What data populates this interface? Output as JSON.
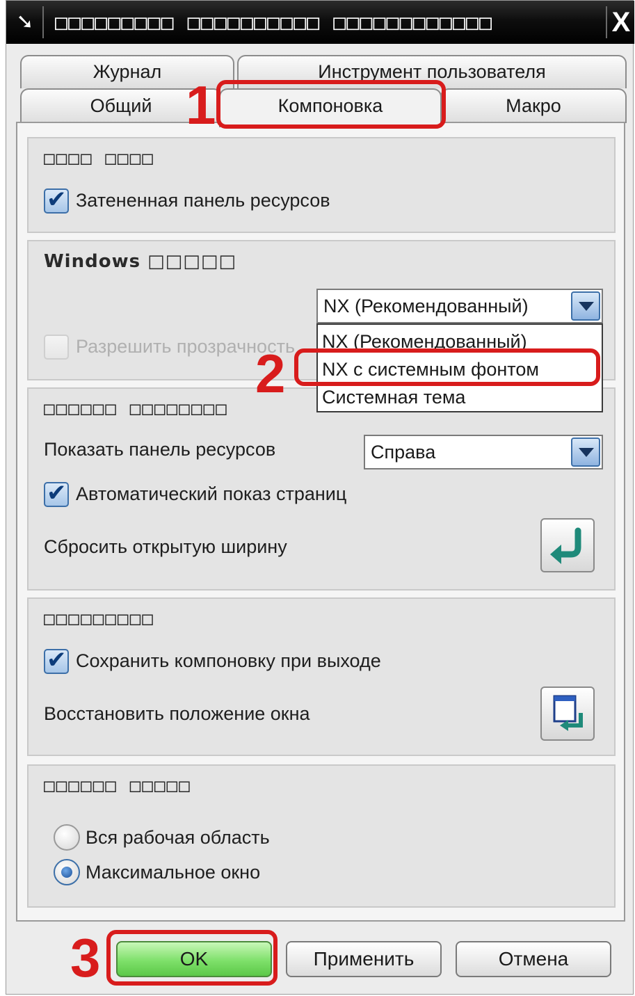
{
  "window": {
    "title": "□□□□□□□□□ □□□□□□□□□□ □□□□□□□□□□□□",
    "title_icon": "pin-icon",
    "close_label": "X"
  },
  "tabs": {
    "journal": "Журнал",
    "user_tool": "Инструмент пользователя",
    "general": "Общий",
    "layout": "Компоновка",
    "macro": "Макро",
    "active": "Компоновка"
  },
  "group_resource": {
    "title": "□□□□ □□□□",
    "shaded_panel_label": "Затененная панель ресурсов",
    "shaded_panel_checked": true
  },
  "group_windows": {
    "title": "Windows □□□□□",
    "theme_selected": "NX (Рекомендованный)",
    "theme_options": [
      "NX (Рекомендованный)",
      "NX с системным фонтом",
      "Системная тема"
    ],
    "highlighted_option": "NX с системным фонтом",
    "transparency_label": "Разрешить прозрачность",
    "transparency_checked": false,
    "transparency_enabled": false
  },
  "group_panel": {
    "title": "□□□□□□ □□□□□□□□",
    "show_panel_label": "Показать панель ресурсов",
    "show_panel_value": "Справа",
    "auto_show_label": "Автоматический показ страниц",
    "auto_show_checked": true,
    "reset_width_label": "Сбросить открытую ширину",
    "reset_icon": "undo-arrow-icon"
  },
  "group_save": {
    "title": "□□□□□□□□□",
    "save_layout_label": "Сохранить компоновку при выходе",
    "save_layout_checked": true,
    "restore_label": "Восстановить положение окна",
    "restore_icon": "window-restore-icon"
  },
  "group_window_size": {
    "title": "□□□□□□ □□□□□",
    "options": [
      "Вся рабочая область",
      "Максимальное окно"
    ],
    "selected": "Максимальное окно"
  },
  "buttons": {
    "ok": "OK",
    "apply": "Применить",
    "cancel": "Отмена"
  },
  "callouts": [
    "1",
    "2",
    "3"
  ],
  "colors": {
    "callout": "#d81c1c",
    "ok_button": "#7ee06a",
    "accent": "#3c6fa8"
  }
}
